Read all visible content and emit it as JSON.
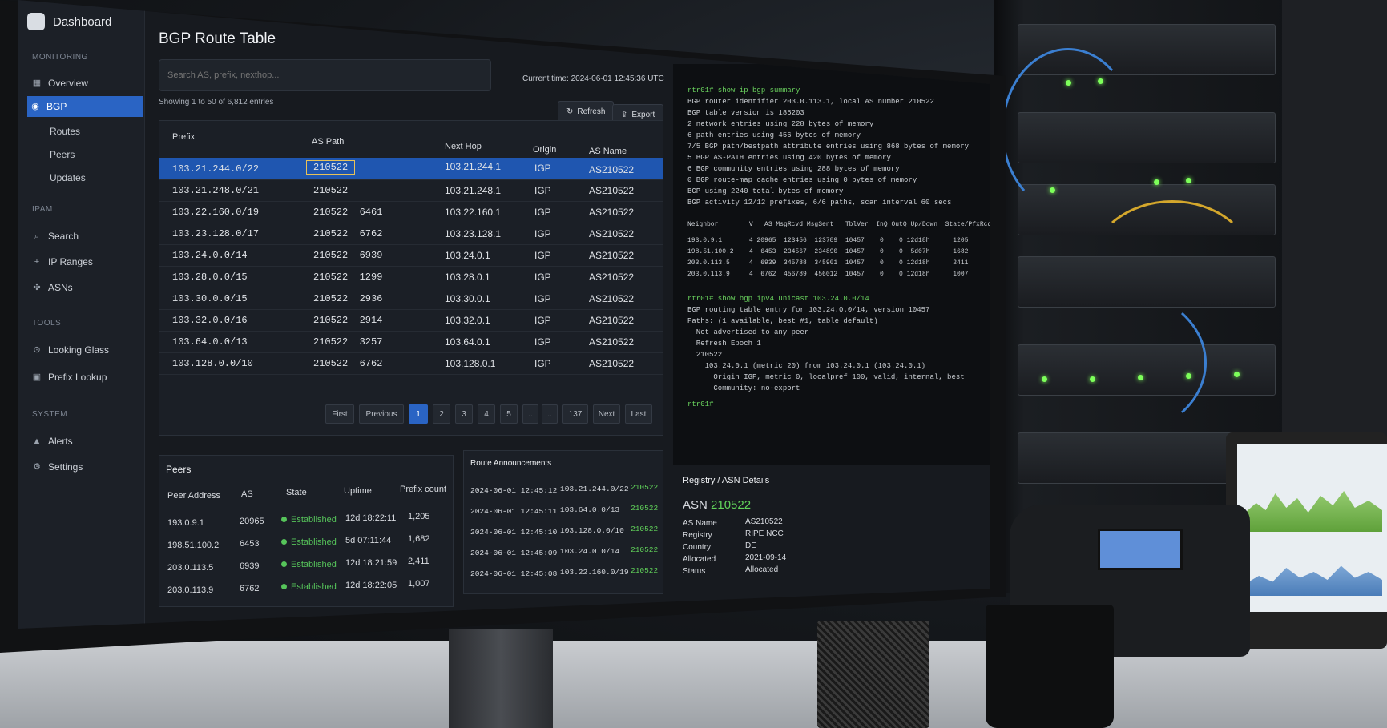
{
  "sidebar": {
    "title": "Dashboard",
    "monitoring_label": "MONITORING",
    "overview": "Overview",
    "bgp": "BGP",
    "routes": "Routes",
    "peers": "Peers",
    "updates": "Updates",
    "ipam_label": "IPAM",
    "search": "Search",
    "ip_ranges": "IP Ranges",
    "asns": "ASNs",
    "tools_label": "TOOLS",
    "looking_glass": "Looking Glass",
    "prefix_lookup": "Prefix Lookup",
    "system_label": "SYSTEM",
    "alerts": "Alerts",
    "settings": "Settings"
  },
  "main": {
    "title": "BGP Route Table",
    "search_placeholder": "Search AS, prefix, nexthop...",
    "current_time": "Current time: 2024-06-01 12:45:36 UTC",
    "showing": "Showing 1 to 50 of 6,812 entries",
    "refresh": "Refresh",
    "export": "Export",
    "accent": "#2a64c4"
  },
  "table": {
    "headers": [
      "Prefix",
      "AS Path",
      "Next Hop",
      "Origin",
      "AS Name"
    ],
    "rows": [
      {
        "prefix": "103.21.244.0/22",
        "aspath": "210522",
        "nexthop": "103.21.244.1",
        "origin": "IGP",
        "asname": "AS210522"
      },
      {
        "prefix": "103.21.248.0/21",
        "aspath": "210522",
        "nexthop": "103.21.248.1",
        "origin": "IGP",
        "asname": "AS210522"
      },
      {
        "prefix": "103.22.160.0/19",
        "aspath": "210522  6461",
        "nexthop": "103.22.160.1",
        "origin": "IGP",
        "asname": "AS210522"
      },
      {
        "prefix": "103.23.128.0/17",
        "aspath": "210522  6762",
        "nexthop": "103.23.128.1",
        "origin": "IGP",
        "asname": "AS210522"
      },
      {
        "prefix": "103.24.0.0/14",
        "aspath": "210522  6939",
        "nexthop": "103.24.0.1",
        "origin": "IGP",
        "asname": "AS210522"
      },
      {
        "prefix": "103.28.0.0/15",
        "aspath": "210522  1299",
        "nexthop": "103.28.0.1",
        "origin": "IGP",
        "asname": "AS210522"
      },
      {
        "prefix": "103.30.0.0/15",
        "aspath": "210522  2936",
        "nexthop": "103.30.0.1",
        "origin": "IGP",
        "asname": "AS210522"
      },
      {
        "prefix": "103.32.0.0/16",
        "aspath": "210522  2914",
        "nexthop": "103.32.0.1",
        "origin": "IGP",
        "asname": "AS210522"
      },
      {
        "prefix": "103.64.0.0/13",
        "aspath": "210522  3257",
        "nexthop": "103.64.0.1",
        "origin": "IGP",
        "asname": "AS210522"
      },
      {
        "prefix": "103.128.0.0/10",
        "aspath": "210522  6762",
        "nexthop": "103.128.0.1",
        "origin": "IGP",
        "asname": "AS210522"
      }
    ]
  },
  "pagination": {
    "first": "First",
    "previous": "Previous",
    "p1": "1",
    "p2": "2",
    "p3": "3",
    "p4": "4",
    "p5": "5",
    "ellipsis": "..",
    "last_page": "137",
    "next": "Next",
    "last": "Last"
  },
  "peers": {
    "title": "Peers",
    "headers": [
      "Peer Address",
      "AS",
      "State",
      "Uptime",
      "Prefix count"
    ],
    "rows": [
      {
        "addr": "193.0.9.1",
        "as": "20965",
        "state": "Established",
        "uptime": "12d 18:22:11",
        "count": "1,205"
      },
      {
        "addr": "198.51.100.2",
        "as": "6453",
        "state": "Established",
        "uptime": "5d 07:11:44",
        "count": "1,682"
      },
      {
        "addr": "203.0.113.5",
        "as": "6939",
        "state": "Established",
        "uptime": "12d 18:21:59",
        "count": "2,411"
      },
      {
        "addr": "203.0.113.9",
        "as": "6762",
        "state": "Established",
        "uptime": "12d 18:22:05",
        "count": "1,007"
      }
    ]
  },
  "announcements": {
    "title": "Route Announcements",
    "rows": [
      {
        "time": "2024-06-01 12:45:12",
        "prefix": "103.21.244.0/22",
        "asn": "210522"
      },
      {
        "time": "2024-06-01 12:45:11",
        "prefix": "103.64.0.0/13",
        "asn": "210522"
      },
      {
        "time": "2024-06-01 12:45:10",
        "prefix": "103.128.0.0/10",
        "asn": "210522"
      },
      {
        "time": "2024-06-01 12:45:09",
        "prefix": "103.24.0.0/14",
        "asn": "210522"
      },
      {
        "time": "2024-06-01 12:45:08",
        "prefix": "103.22.160.0/19",
        "asn": "210522"
      }
    ]
  },
  "terminal": {
    "lines": [
      "rtr01# show ip bgp summary",
      "BGP router identifier 203.0.113.1, local AS number 210522",
      "BGP table version is 185203",
      "2 network entries using 228 bytes of memory",
      "6 path entries using 456 bytes of memory",
      "7/5 BGP path/bestpath attribute entries using 868 bytes of memory",
      "5 BGP AS-PATH entries using 420 bytes of memory",
      "6 BGP community entries using 288 bytes of memory",
      "0 BGP route-map cache entries using 0 bytes of memory",
      "BGP using 2240 total bytes of memory",
      "BGP activity 12/12 prefixes, 6/6 paths, scan interval 60 secs",
      "",
      "Neighbor        V   AS MsgRcvd MsgSent   TblVer  InQ OutQ Up/Down  State/PfxRcd",
      "193.0.9.1       4 20965  123456  123789  10457    0    0 12d18h      1205",
      "198.51.100.2    4  6453  234567  234890  10457    0    0  5d07h      1682",
      "203.0.113.5     4  6939  345788  345901  10457    0    0 12d18h      2411",
      "203.0.113.9     4  6762  456789  456012  10457    0    0 12d18h      1007",
      "",
      "rtr01# show bgp ipv4 unicast 103.24.0.0/14",
      "BGP routing table entry for 103.24.0.0/14, version 10457",
      "Paths: (1 available, best #1, table default)",
      "  Not advertised to any peer",
      "  Refresh Epoch 1",
      "  210522",
      "    103.24.0.1 (metric 20) from 103.24.0.1 (103.24.0.1)",
      "      Origin IGP, metric 0, localpref 100, valid, internal, best",
      "      Community: no-export",
      "rtr01# |"
    ]
  },
  "registry": {
    "title": "Registry / ASN Details",
    "asn_label": "ASN",
    "asn_value": "210522",
    "fields": [
      {
        "k": "AS Name",
        "v": "AS210522"
      },
      {
        "k": "Registry",
        "v": "RIPE NCC"
      },
      {
        "k": "Country",
        "v": "DE"
      },
      {
        "k": "Allocated",
        "v": "2021-09-14"
      },
      {
        "k": "Status",
        "v": "Allocated"
      }
    ]
  }
}
